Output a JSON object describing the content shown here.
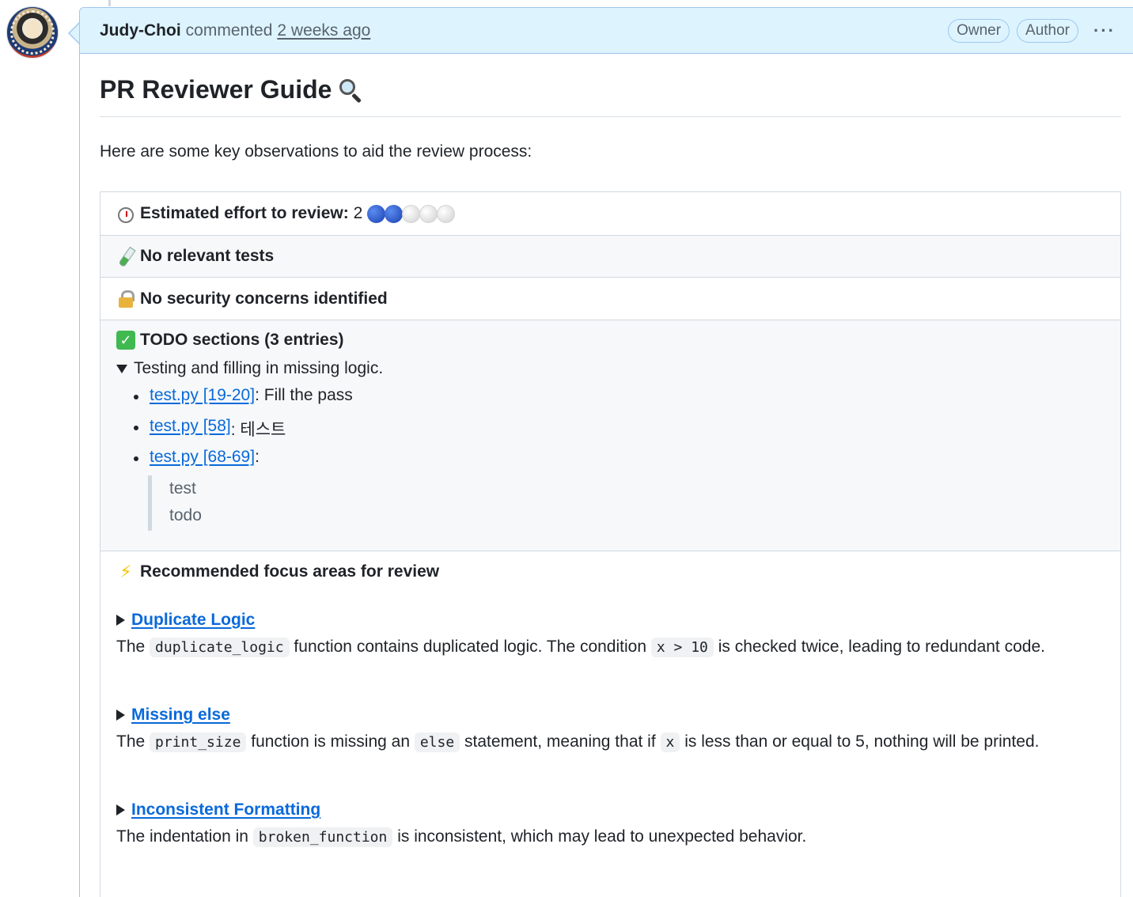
{
  "comment": {
    "author": "Judy-Choi",
    "action": "commented",
    "time": "2 weeks ago",
    "badges": [
      "Owner",
      "Author"
    ],
    "menu_icon": "kebab-horizontal-icon"
  },
  "guide": {
    "title": "PR Reviewer Guide",
    "intro": "Here are some key observations to aid the review process:",
    "effort": {
      "label": "Estimated effort to review",
      "value": "2",
      "scale_filled": 2,
      "scale_total": 5
    },
    "tests": "No relevant tests",
    "security": "No security concerns identified",
    "todo": {
      "heading": "TODO sections (3 entries)",
      "summary": "Testing and filling in missing logic.",
      "items": [
        {
          "link": "test.py [19-20]",
          "text": ": Fill the pass"
        },
        {
          "link": "test.py [58]",
          "text": ": 테스트"
        },
        {
          "link": "test.py [68-69]",
          "text": ":"
        }
      ],
      "quote_lines": [
        "test",
        "todo"
      ]
    },
    "focus": {
      "heading": "Recommended focus areas for review",
      "items": [
        {
          "title": "Duplicate Logic",
          "parts": [
            "The ",
            "duplicate_logic",
            " function contains duplicated logic. The condition ",
            "x > 10",
            " is checked twice, leading to redundant code."
          ]
        },
        {
          "title": "Missing else",
          "parts": [
            "The ",
            "print_size",
            " function is missing an ",
            "else",
            " statement, meaning that if ",
            "x",
            " is less than or equal to 5, nothing will be printed."
          ]
        },
        {
          "title": "Inconsistent Formatting",
          "parts": [
            "The indentation in ",
            "broken_function",
            " is inconsistent, which may lead to unexpected behavior."
          ]
        }
      ]
    }
  }
}
